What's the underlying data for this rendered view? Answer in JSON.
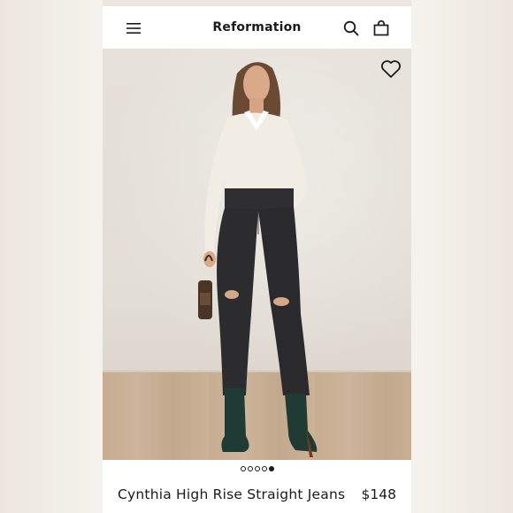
{
  "header": {
    "brand": "Reformation",
    "menu_icon": "hamburger-menu-icon",
    "search_icon": "search-icon",
    "bag_icon": "shopping-bag-icon"
  },
  "product": {
    "name": "Cynthia High Rise Straight Jeans",
    "price": "$148",
    "wishlist_icon": "heart-outline-icon",
    "image_alt": "Model wearing black distressed high rise straight jeans, white cropped polo, green boots"
  },
  "carousel": {
    "total": 5,
    "active_index": 4
  },
  "colors": {
    "text": "#1a1a1a",
    "background": "#ffffff"
  }
}
